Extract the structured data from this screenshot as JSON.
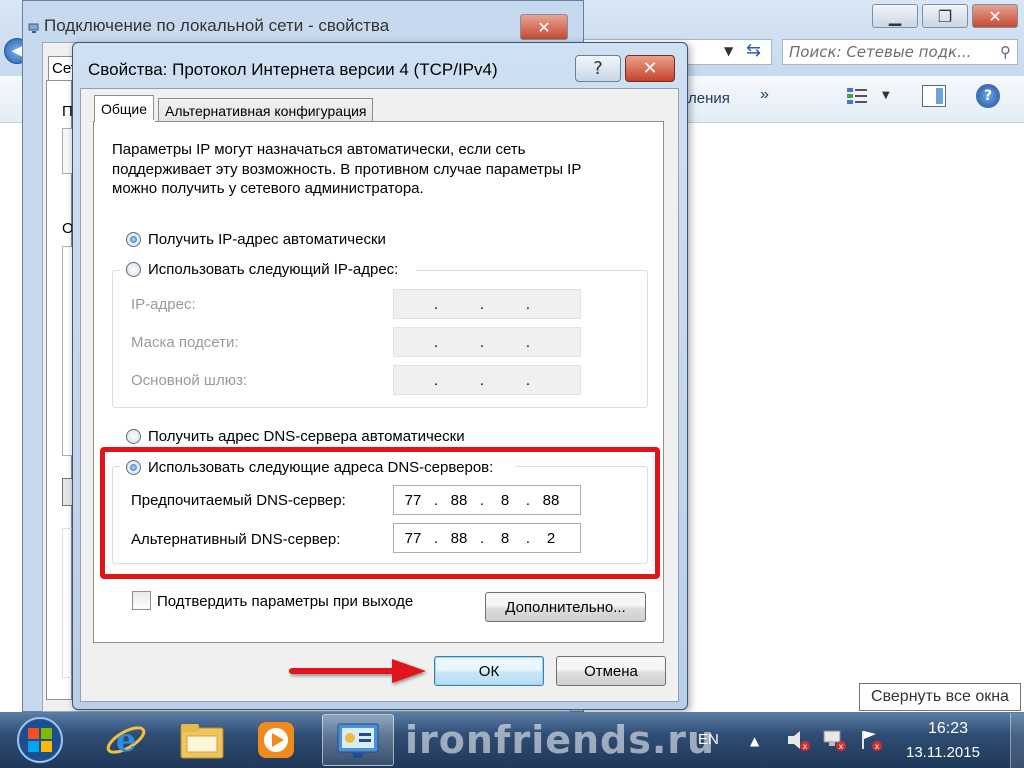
{
  "explorer": {
    "search_placeholder": "Поиск: Сетевые подк...",
    "cmd_partial": "ления",
    "chevron": "»"
  },
  "props_window": {
    "title": "Подключение по локальной сети - свойства",
    "frag_tab": "Сеть",
    "frag_p": "П",
    "frag_o": "О"
  },
  "dialog": {
    "title": "Свойства: Протокол Интернета версии 4 (TCP/IPv4)",
    "help_label": "?",
    "close_label": "✕",
    "tabs": [
      "Общие",
      "Альтернативная конфигурация"
    ],
    "description": [
      "Параметры IP могут назначаться автоматически, если сеть",
      "поддерживает эту возможность. В противном случае параметры IP",
      "можно получить у сетевого администратора."
    ],
    "ip_auto_label": "Получить IP-адрес автоматически",
    "ip_manual_label": "Использовать следующий IP-адрес:",
    "ip_fields": [
      {
        "label": "IP-адрес:"
      },
      {
        "label": "Маска подсети:"
      },
      {
        "label": "Основной шлюз:"
      }
    ],
    "dns_auto_label": "Получить адрес DNS-сервера автоматически",
    "dns_manual_label": "Использовать следующие адреса DNS-серверов:",
    "dns_fields": [
      {
        "label": "Предпочитаемый DNS-сервер:",
        "octets": [
          "77",
          "88",
          "8",
          "88"
        ]
      },
      {
        "label": "Альтернативный DNS-сервер:",
        "octets": [
          "77",
          "88",
          "8",
          "2"
        ]
      }
    ],
    "validate_label": "Подтвердить параметры при выходе",
    "advanced_label": "Дополнительно...",
    "ok_label": "ОК",
    "cancel_label": "Отмена",
    "selected": {
      "ip": "auto",
      "dns": "manual",
      "validate": false
    }
  },
  "tooltip": "Свернуть все окна",
  "taskbar": {
    "watermark": "ironfriends.ru",
    "lang": "EN",
    "time": "16:23",
    "date": "13.11.2015",
    "icons": [
      "start-orb-icon",
      "internet-explorer-icon",
      "explorer-folder-icon",
      "media-player-icon",
      "network-control-panel-icon"
    ]
  },
  "colors": {
    "highlight": "#e0151a",
    "arrow": "#e0151a",
    "taskbar": "#2f4d74"
  }
}
